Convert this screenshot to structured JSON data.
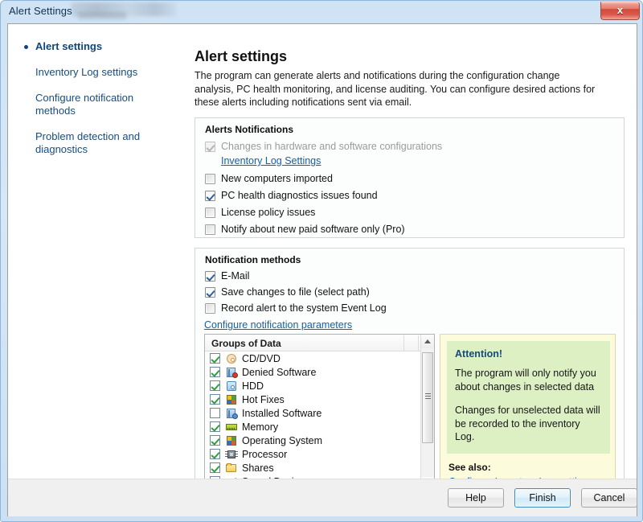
{
  "window": {
    "title": "Alert Settings",
    "close_label": "x",
    "accent_blue": "#1160a8",
    "link_color": "#1160a8",
    "attention_title_color": "#16487e",
    "attention_bg": "#fcfbdc",
    "attention_inner_bg": "#ddf0c4"
  },
  "sidebar": {
    "items": [
      {
        "label": "Alert settings",
        "current": true
      },
      {
        "label": "Inventory Log settings",
        "current": false
      },
      {
        "label": "Configure notification methods",
        "current": false
      },
      {
        "label": "Problem detection and diagnostics",
        "current": false
      }
    ]
  },
  "main": {
    "title": "Alert settings",
    "description": "The program can generate alerts and notifications during the configuration change analysis, PC health monitoring, and license auditing. You can configure desired actions for these alerts including notifications sent via email."
  },
  "alerts_group": {
    "title": "Alerts Notifications",
    "items": [
      {
        "label": "Changes in hardware and software configurations",
        "checked": true,
        "disabled": true
      },
      {
        "label": "New computers imported",
        "checked": false,
        "disabled": false
      },
      {
        "label": "PC health diagnostics issues found",
        "checked": true,
        "disabled": false
      },
      {
        "label": "License policy issues",
        "checked": false,
        "disabled": false
      },
      {
        "label": "Notify about new paid software only (Pro)",
        "checked": false,
        "disabled": false
      }
    ],
    "inventory_link": "Inventory Log Settings"
  },
  "methods_group": {
    "title": "Notification methods",
    "items": [
      {
        "label": "E-Mail",
        "checked": true
      },
      {
        "label": "Save changes to file (select path)",
        "checked": true
      },
      {
        "label": "Record alert to the system Event Log",
        "checked": false
      }
    ],
    "configure_link": "Configure notification parameters"
  },
  "groups_list": {
    "header": "Groups of Data",
    "rows": [
      {
        "label": "CD/DVD",
        "checked": true,
        "icon": "cd-icon"
      },
      {
        "label": "Denied Software",
        "checked": true,
        "icon": "denied-software-icon"
      },
      {
        "label": "HDD",
        "checked": true,
        "icon": "hdd-icon"
      },
      {
        "label": "Hot Fixes",
        "checked": true,
        "icon": "hotfix-icon"
      },
      {
        "label": "Installed Software",
        "checked": false,
        "icon": "installed-software-icon"
      },
      {
        "label": "Memory",
        "checked": true,
        "icon": "memory-icon"
      },
      {
        "label": "Operating System",
        "checked": true,
        "icon": "os-icon"
      },
      {
        "label": "Processor",
        "checked": true,
        "icon": "processor-icon"
      },
      {
        "label": "Shares",
        "checked": true,
        "icon": "shares-icon"
      },
      {
        "label": "Sound Devices",
        "checked": true,
        "icon": "sound-devices-icon"
      }
    ]
  },
  "attention": {
    "title": "Attention!",
    "paragraph1": "The program will only notify you about changes in selected data",
    "paragraph2": "Changes for unselected data will be recorded to the inventory Log.",
    "see_also_label": "See also:",
    "see_also_link": "Configure Inventory Log settings"
  },
  "footer": {
    "help_label": "Help",
    "finish_label": "Finish",
    "cancel_label": "Cancel"
  }
}
